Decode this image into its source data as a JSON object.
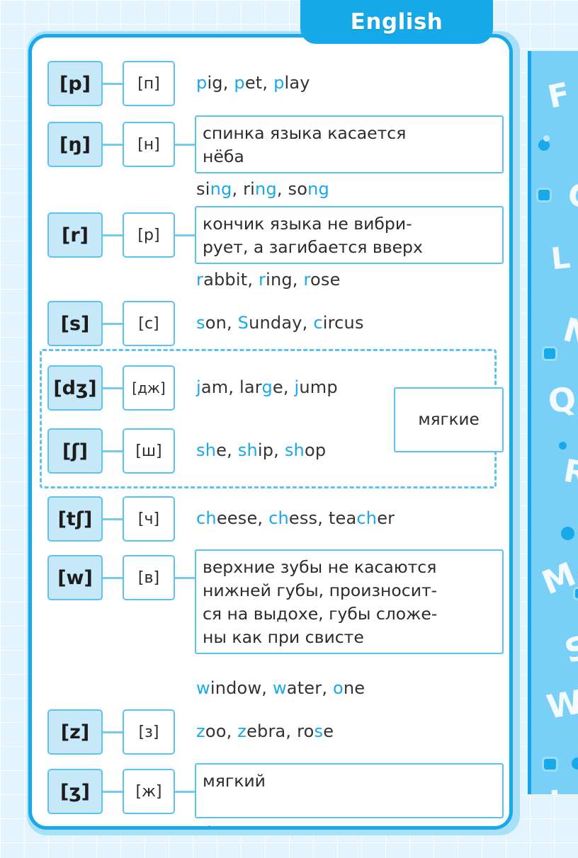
{
  "header": {
    "title": "English"
  },
  "soft_group": {
    "label": "мягкие"
  },
  "rows": [
    {
      "ipa": "[p]",
      "cyrillic": "[п]",
      "note": null,
      "examples": [
        {
          "parts": [
            {
              "t": "p",
              "hl": true
            },
            {
              "t": "ig, ",
              "hl": false
            }
          ]
        },
        {
          "parts": [
            {
              "t": "p",
              "hl": true
            },
            {
              "t": "et, ",
              "hl": false
            }
          ]
        },
        {
          "parts": [
            {
              "t": "p",
              "hl": true
            },
            {
              "t": "lay",
              "hl": false
            }
          ]
        }
      ],
      "examples_text": "pig, pet, play"
    },
    {
      "ipa": "[ŋ]",
      "cyrillic": "[н]",
      "note": "спинка языка касается нёба",
      "examples_text": "sing, ring, song"
    },
    {
      "ipa": "[r]",
      "cyrillic": "[р]",
      "note": "кончик языка не вибри-рует, а загибается вверх",
      "examples_text": "rabbit, ring, rose"
    },
    {
      "ipa": "[s]",
      "cyrillic": "[с]",
      "note": null,
      "examples_text": "son, Sunday, circus"
    },
    {
      "ipa": "[dʒ]",
      "cyrillic": "[дж]",
      "note": null,
      "examples_text": "jam, large, jump"
    },
    {
      "ipa": "[ʃ]",
      "cyrillic": "[ш]",
      "note": null,
      "examples_text": "she, ship, shop"
    },
    {
      "ipa": "[tʃ]",
      "cyrillic": "[ч]",
      "note": null,
      "examples_text": "cheese, chess, teacher"
    },
    {
      "ipa": "[w]",
      "cyrillic": "[в]",
      "note": "верхние зубы не касаются нижней губы, произносит-ся на выдохе, губы сложе-ны как при свисте",
      "examples_text": "window, water, one"
    },
    {
      "ipa": "[z]",
      "cyrillic": "[з]",
      "note": null,
      "examples_text": "zoo, zebra, rose"
    },
    {
      "ipa": "[ʒ]",
      "cyrillic": "[ж]",
      "note": "мягкий",
      "examples_text": "pleasure, measure"
    }
  ],
  "notes": {
    "ng_line1": "спинка языка касается",
    "ng_line2": "нёба",
    "r_line1": "кончик языка не вибри-",
    "r_line2": "рует, а загибается вверх",
    "w_line1": "верхние зубы не касаются",
    "w_line2": "нижней губы, произносит-",
    "w_line3": "ся на выдохе, губы сложе-",
    "w_line4": "ны как при свисте",
    "zh_line1": "мягкий"
  },
  "decor_rail": {
    "letters": [
      "F",
      "G",
      "L",
      "N",
      "Q",
      "R",
      "M",
      "S",
      "W",
      "J"
    ]
  },
  "colors": {
    "accent": "#17a9ea",
    "accent_light": "#79d0f7",
    "box_fill": "#c6e8f9",
    "border": "#5cc3ef",
    "page_bg": "#e4f4fd",
    "text": "#2b2b2b"
  }
}
